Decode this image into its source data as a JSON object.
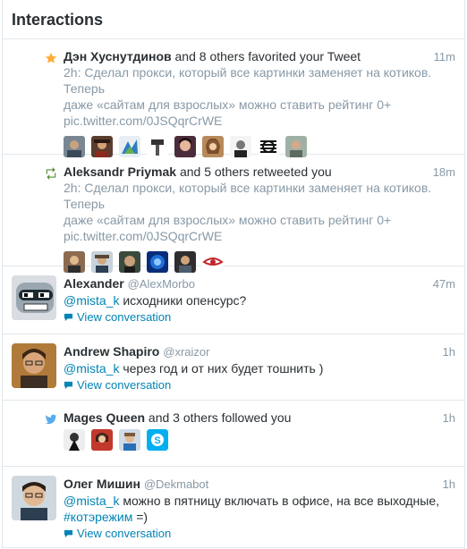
{
  "header": {
    "title": "Interactions"
  },
  "items": [
    {
      "actor": "Дэн Хуснутдинов",
      "action": " and 8 others favorited your Tweet",
      "time": "11m",
      "tweet_line1": "2h: Сделал прокси, который все картинки заменяет на котиков. Теперь",
      "tweet_line2": "даже «сайтам для взрослых» можно ставить рейтинг 0+",
      "tweet_line3": "pic.twitter.com/0JSQqrCrWE",
      "icon": "star-icon"
    },
    {
      "actor": "Aleksandr Priymak",
      "action": " and 5 others retweeted you",
      "time": "18m",
      "tweet_line1": "2h: Сделал прокси, который все картинки заменяет на котиков. Теперь",
      "tweet_line2": "даже «сайтам для взрослых» можно ставить рейтинг 0+",
      "tweet_line3": "pic.twitter.com/0JSQqrCrWE",
      "icon": "retweet-icon"
    },
    {
      "name": "Alexander",
      "screen": "@AlexMorbo",
      "time": "47m",
      "mention": "@mista_k",
      "text": " исходники опенсурс?",
      "view": "View conversation"
    },
    {
      "name": "Andrew Shapiro",
      "screen": "@xraizor",
      "time": "1h",
      "mention": "@mista_k",
      "text": " через год и от них будет тошнить )",
      "view": "View conversation"
    },
    {
      "actor": "Mages Queen",
      "action": " and 3 others followed you",
      "time": "1h",
      "icon": "twitter-bird-icon"
    },
    {
      "name": "Олег Мишин",
      "screen": "@Dekmabot",
      "time": "1h",
      "mention": "@mista_k",
      "text": " можно в пятницу включать в офисе, на все выходные,",
      "hashtag": "#котэрежим",
      "text2": " =)",
      "view": "View conversation"
    }
  ],
  "colors": {
    "link": "#0084b4",
    "meta": "#8899a6",
    "text": "#292f33",
    "star": "#ffac33",
    "retweet": "#5c913b",
    "bird": "#55acee"
  }
}
